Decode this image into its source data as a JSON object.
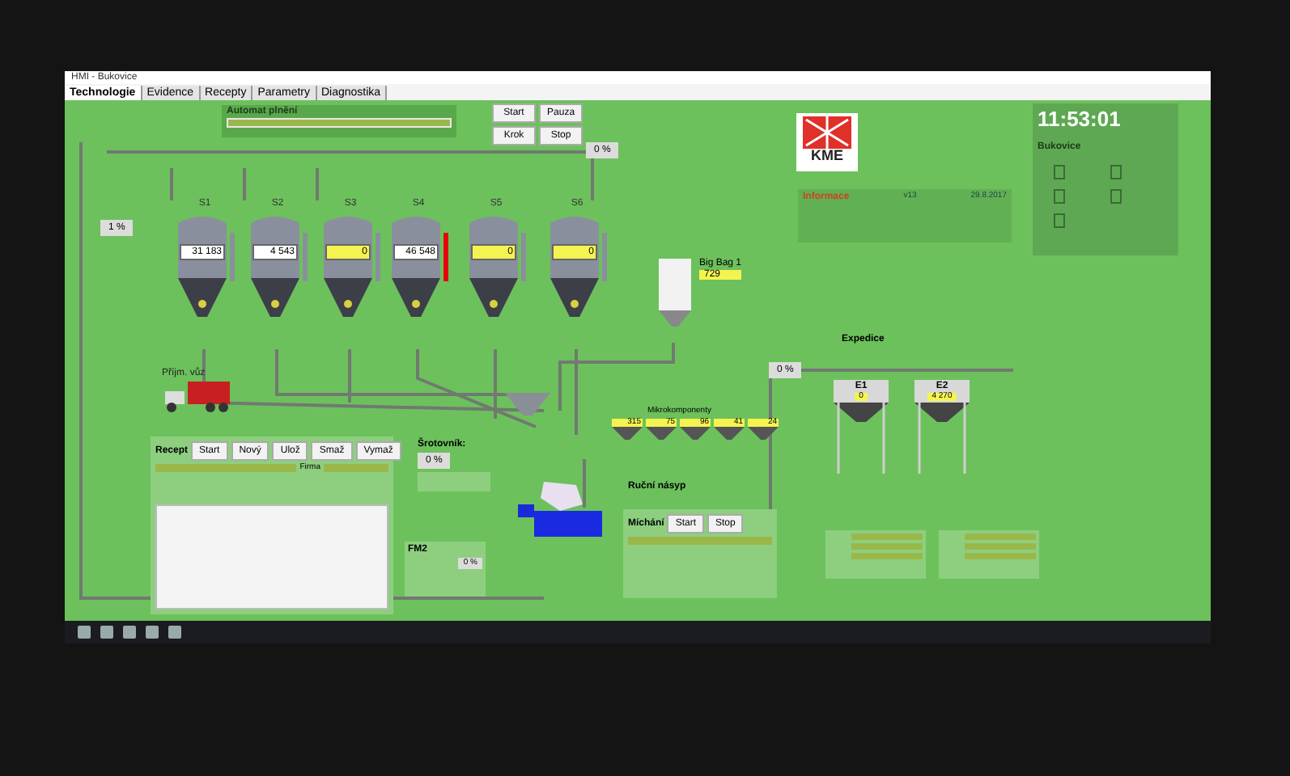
{
  "window": {
    "title": "HMI - Bukovice"
  },
  "tabs": [
    {
      "label": "Technologie",
      "selected": true
    },
    {
      "label": "Evidence",
      "selected": false
    },
    {
      "label": "Recepty",
      "selected": false
    },
    {
      "label": "Parametry",
      "selected": false
    },
    {
      "label": "Diagnostika",
      "selected": false
    }
  ],
  "automat": {
    "title": "Automat plnění",
    "buttons": [
      "Start",
      "Pauza",
      "Krok",
      "Stop"
    ],
    "percent": "0 %"
  },
  "left_percent": "1 %",
  "silos": [
    {
      "name": "S1",
      "value": "31 183",
      "warning": false,
      "alarm": false
    },
    {
      "name": "S2",
      "value": "4 543",
      "warning": false,
      "alarm": false
    },
    {
      "name": "S3",
      "value": "0",
      "warning": true,
      "alarm": false
    },
    {
      "name": "S4",
      "value": "46 548",
      "warning": false,
      "alarm": true
    },
    {
      "name": "S5",
      "value": "0",
      "warning": true,
      "alarm": false
    },
    {
      "name": "S6",
      "value": "0",
      "warning": true,
      "alarm": false
    }
  ],
  "logo": "KME",
  "clock": {
    "time": "11:53:01",
    "site": "Bukovice"
  },
  "info": {
    "title": "Informace",
    "version": "v13",
    "date": "29.8.2017"
  },
  "big_bag": {
    "label": "Big Bag 1",
    "value": "729"
  },
  "truck": {
    "label": "Příjm. vůz"
  },
  "expedice": {
    "title": "Expedice",
    "percent": "0 %",
    "bins": [
      {
        "name": "E1",
        "value": "0"
      },
      {
        "name": "E2",
        "value": "4 270"
      }
    ]
  },
  "micro": {
    "title": "Mikrokomponenty",
    "values": [
      "315",
      "75",
      "96",
      "41",
      "24"
    ]
  },
  "manual": {
    "title": "Ruční násyp"
  },
  "mixer": {
    "title": "Míchání",
    "buttons": [
      "Start",
      "Stop"
    ]
  },
  "grinder": {
    "title": "Šrotovník:",
    "percent": "0 %"
  },
  "recipe": {
    "title": "Recept",
    "buttons": [
      "Start",
      "Nový",
      "Ulož",
      "Smaž",
      "Vymaž"
    ],
    "label": "Firma"
  },
  "fm": {
    "label": "FM2",
    "value": "0 %"
  }
}
